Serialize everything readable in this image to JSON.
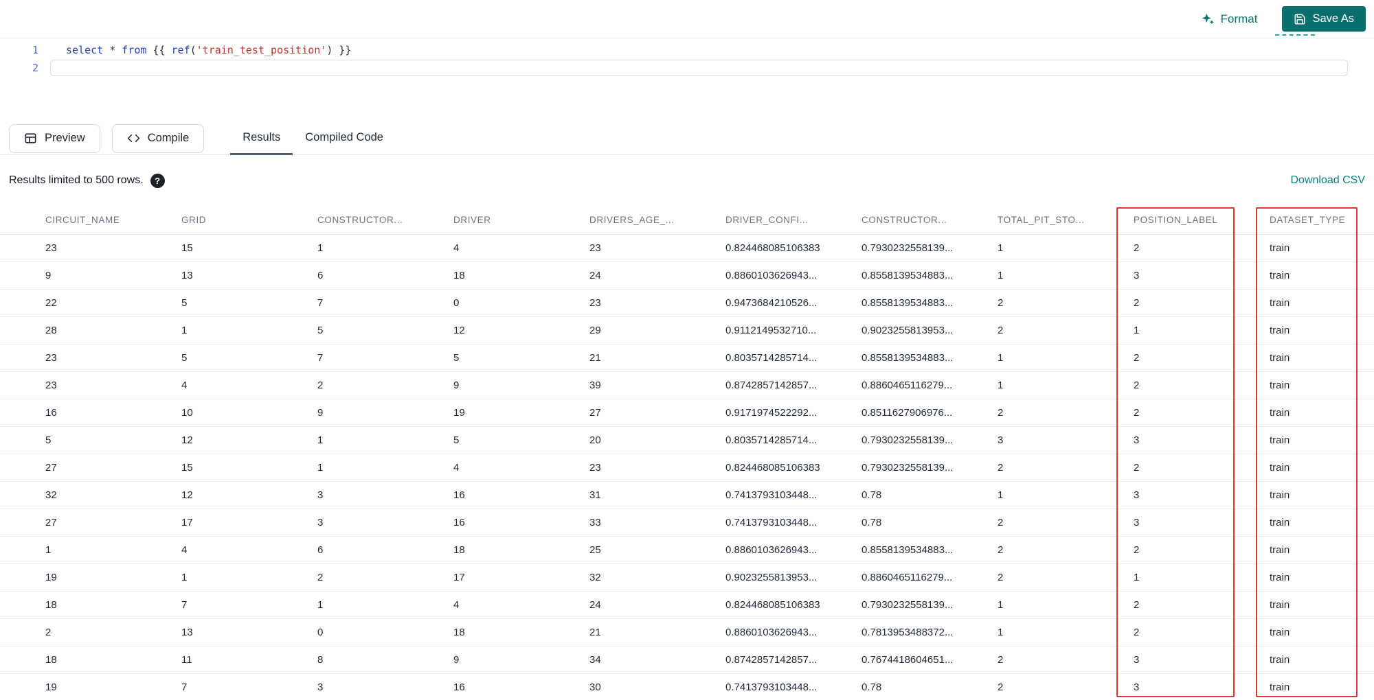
{
  "toolbar": {
    "format_label": "Format",
    "save_as_label": "Save As"
  },
  "editor": {
    "lines": [
      {
        "number": "1"
      },
      {
        "number": "2"
      }
    ],
    "code": {
      "kw_select": "select",
      "op_star": " * ",
      "kw_from": "from",
      "brace_open": " {{ ",
      "fn_ref": "ref",
      "paren_open": "(",
      "string_arg": "'train_test_position'",
      "paren_close": ")",
      "brace_close": " }}"
    }
  },
  "actions": {
    "preview_label": "Preview",
    "compile_label": "Compile"
  },
  "tabs": [
    {
      "label": "Results",
      "active": true
    },
    {
      "label": "Compiled Code",
      "active": false
    }
  ],
  "results": {
    "limit_text": "Results limited to 500 rows.",
    "help_glyph": "?",
    "download_label": "Download CSV"
  },
  "table": {
    "columns": [
      "CIRCUIT_NAME",
      "GRID",
      "CONSTRUCTOR...",
      "DRIVER",
      "DRIVERS_AGE_...",
      "DRIVER_CONFI...",
      "CONSTRUCTOR...",
      "TOTAL_PIT_STO...",
      "POSITION_LABEL",
      "DATASET_TYPE"
    ],
    "highlighted_columns": [
      "POSITION_LABEL",
      "DATASET_TYPE"
    ],
    "highlight_color": "#e5322e",
    "rows": [
      [
        "23",
        "15",
        "1",
        "4",
        "23",
        "0.824468085106383",
        "0.7930232558139...",
        "1",
        "2",
        "train"
      ],
      [
        "9",
        "13",
        "6",
        "18",
        "24",
        "0.8860103626943...",
        "0.8558139534883...",
        "1",
        "3",
        "train"
      ],
      [
        "22",
        "5",
        "7",
        "0",
        "23",
        "0.9473684210526...",
        "0.8558139534883...",
        "2",
        "2",
        "train"
      ],
      [
        "28",
        "1",
        "5",
        "12",
        "29",
        "0.9112149532710...",
        "0.9023255813953...",
        "2",
        "1",
        "train"
      ],
      [
        "23",
        "5",
        "7",
        "5",
        "21",
        "0.8035714285714...",
        "0.8558139534883...",
        "1",
        "2",
        "train"
      ],
      [
        "23",
        "4",
        "2",
        "9",
        "39",
        "0.8742857142857...",
        "0.8860465116279...",
        "1",
        "2",
        "train"
      ],
      [
        "16",
        "10",
        "9",
        "19",
        "27",
        "0.9171974522292...",
        "0.8511627906976...",
        "2",
        "2",
        "train"
      ],
      [
        "5",
        "12",
        "1",
        "5",
        "20",
        "0.8035714285714...",
        "0.7930232558139...",
        "3",
        "3",
        "train"
      ],
      [
        "27",
        "15",
        "1",
        "4",
        "23",
        "0.824468085106383",
        "0.7930232558139...",
        "2",
        "2",
        "train"
      ],
      [
        "32",
        "12",
        "3",
        "16",
        "31",
        "0.7413793103448...",
        "0.78",
        "1",
        "3",
        "train"
      ],
      [
        "27",
        "17",
        "3",
        "16",
        "33",
        "0.7413793103448...",
        "0.78",
        "2",
        "3",
        "train"
      ],
      [
        "1",
        "4",
        "6",
        "18",
        "25",
        "0.8860103626943...",
        "0.8558139534883...",
        "2",
        "2",
        "train"
      ],
      [
        "19",
        "1",
        "2",
        "17",
        "32",
        "0.9023255813953...",
        "0.8860465116279...",
        "2",
        "1",
        "train"
      ],
      [
        "18",
        "7",
        "1",
        "4",
        "24",
        "0.824468085106383",
        "0.7930232558139...",
        "1",
        "2",
        "train"
      ],
      [
        "2",
        "13",
        "0",
        "18",
        "21",
        "0.8860103626943...",
        "0.7813953488372...",
        "1",
        "2",
        "train"
      ],
      [
        "18",
        "11",
        "8",
        "9",
        "34",
        "0.8742857142857...",
        "0.7674418604651...",
        "2",
        "3",
        "train"
      ],
      [
        "19",
        "7",
        "3",
        "16",
        "30",
        "0.7413793103448...",
        "0.78",
        "2",
        "3",
        "train"
      ]
    ]
  },
  "colors": {
    "accent_teal": "#0a7474",
    "keyword_blue": "#2440c8",
    "string_red": "#c43530",
    "highlight_red": "#e5322e"
  }
}
